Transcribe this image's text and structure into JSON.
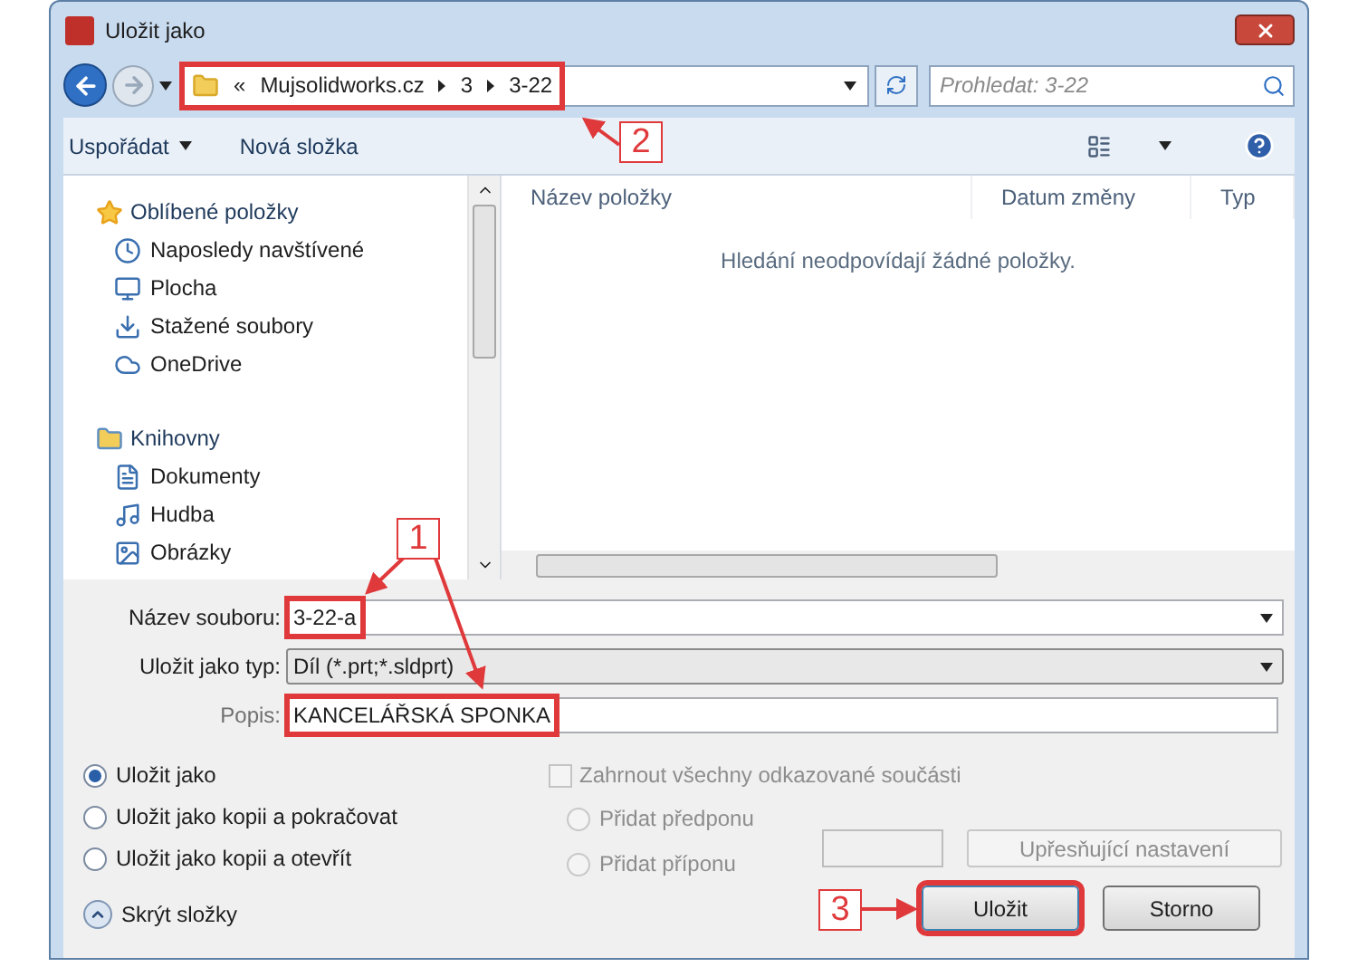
{
  "window": {
    "title": "Uložit jako"
  },
  "address_bar": {
    "segments": [
      "«",
      "Mujsolidworks.cz",
      "3",
      "3-22"
    ],
    "highlighted": true
  },
  "search": {
    "placeholder": "Prohledat: 3-22"
  },
  "toolbar": {
    "organize": "Uspořádat",
    "new_folder": "Nová složka"
  },
  "navigation": [
    {
      "label": "Oblíbené položky",
      "children": [
        {
          "label": "Naposledy navštívené"
        },
        {
          "label": "Plocha"
        },
        {
          "label": "Stažené soubory"
        },
        {
          "label": "OneDrive"
        }
      ]
    },
    {
      "label": "Knihovny",
      "children": [
        {
          "label": "Dokumenty"
        },
        {
          "label": "Hudba"
        },
        {
          "label": "Obrázky"
        }
      ]
    }
  ],
  "file_list": {
    "columns": [
      "Název položky",
      "Datum změny",
      "Typ"
    ],
    "empty_message": "Hledání neodpovídají žádné položky."
  },
  "form": {
    "fields": [
      {
        "label": "Název souboru:",
        "value": "3-22-a",
        "kind": "combo",
        "highlighted": true,
        "label_muted": false
      },
      {
        "label": "Uložit jako typ:",
        "value": "Díl (*.prt;*.sldprt)",
        "kind": "select",
        "highlighted": false,
        "label_muted": false
      },
      {
        "label": "Popis:",
        "value": "KANCELÁŘSKÁ SPONKA",
        "kind": "text",
        "highlighted": true,
        "label_muted": true
      }
    ]
  },
  "save_options": [
    {
      "label": "Uložit jako",
      "selected": true
    },
    {
      "label": "Uložit jako kopii a pokračovat",
      "selected": false
    },
    {
      "label": "Uložit jako kopii a otevřít",
      "selected": false
    }
  ],
  "include_references": {
    "label": "Zahrnout všechny odkazované součásti",
    "checked": false,
    "disabled": true
  },
  "affix_options": [
    {
      "label": "Přidat předponu",
      "selected": false,
      "disabled": true
    },
    {
      "label": "Přidat příponu",
      "selected": false,
      "disabled": true
    }
  ],
  "advanced_button": {
    "label": "Upřesňující nastavení",
    "disabled": true
  },
  "hide_folders": "Skrýt složky",
  "buttons": [
    {
      "label": "Uložit",
      "highlighted": true
    },
    {
      "label": "Storno",
      "highlighted": false
    }
  ],
  "annotations": [
    {
      "label": "1"
    },
    {
      "label": "2"
    },
    {
      "label": "3"
    }
  ]
}
